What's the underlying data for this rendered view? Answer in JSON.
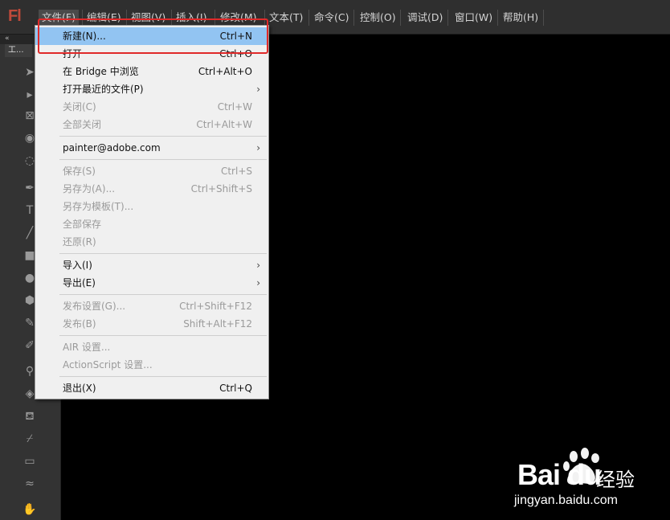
{
  "app": {
    "logo": "Fl"
  },
  "menubar": [
    {
      "label": "文件(F)",
      "active": true
    },
    {
      "label": "编辑(E)"
    },
    {
      "label": "视图(V)"
    },
    {
      "label": "插入(I)"
    },
    {
      "label": "修改(M)"
    },
    {
      "label": "文本(T)"
    },
    {
      "label": "命令(C)"
    },
    {
      "label": "控制(O)"
    },
    {
      "label": "调试(D)"
    },
    {
      "label": "窗口(W)"
    },
    {
      "label": "帮助(H)"
    }
  ],
  "toolpanel": {
    "collapse_label": "«",
    "tab_label": "工..."
  },
  "file_menu": {
    "items": [
      {
        "label": "新建(N)...",
        "shortcut": "Ctrl+N",
        "highlight": true
      },
      {
        "label": "打开",
        "shortcut": "Ctrl+O"
      },
      {
        "label": "在 Bridge 中浏览",
        "shortcut": "Ctrl+Alt+O"
      },
      {
        "label": "打开最近的文件(P)",
        "submenu": true
      },
      {
        "label": "关闭(C)",
        "shortcut": "Ctrl+W",
        "disabled": true
      },
      {
        "label": "全部关闭",
        "shortcut": "Ctrl+Alt+W",
        "disabled": true
      },
      {
        "label": "painter@adobe.com",
        "submenu": true
      },
      {
        "label": "保存(S)",
        "shortcut": "Ctrl+S",
        "disabled": true
      },
      {
        "label": "另存为(A)...",
        "shortcut": "Ctrl+Shift+S",
        "disabled": true
      },
      {
        "label": "另存为模板(T)...",
        "disabled": true
      },
      {
        "label": "全部保存",
        "disabled": true
      },
      {
        "label": "还原(R)",
        "disabled": true
      },
      {
        "label": "导入(I)",
        "submenu": true
      },
      {
        "label": "导出(E)",
        "submenu": true
      },
      {
        "label": "发布设置(G)...",
        "shortcut": "Ctrl+Shift+F12",
        "disabled": true
      },
      {
        "label": "发布(B)",
        "shortcut": "Shift+Alt+F12",
        "disabled": true
      },
      {
        "label": "AIR 设置...",
        "disabled": true
      },
      {
        "label": "ActionScript 设置...",
        "disabled": true
      },
      {
        "label": "退出(X)",
        "shortcut": "Ctrl+Q"
      }
    ],
    "submenu_arrow": "›"
  },
  "watermark": {
    "brand": "Bai du",
    "jy": "经验",
    "url": "jingyan.baidu.com"
  }
}
